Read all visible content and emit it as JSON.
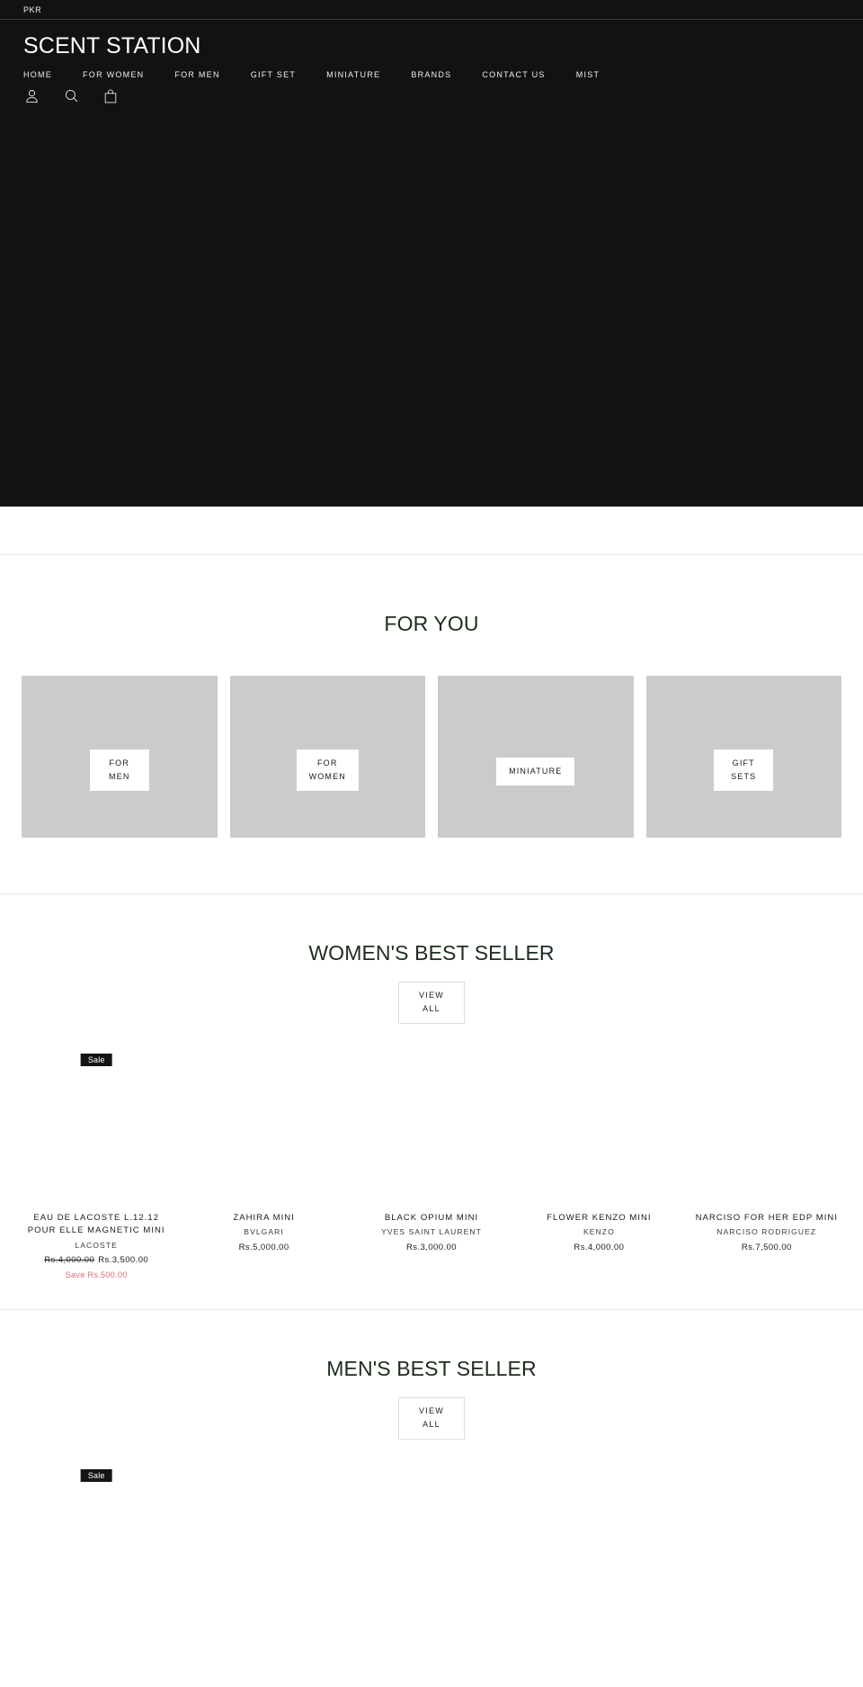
{
  "header": {
    "currency": "PKR",
    "brand_title": "SCENT STATION",
    "nav": [
      {
        "label": "HOME"
      },
      {
        "label": "FOR WOMEN"
      },
      {
        "label": "FOR MEN"
      },
      {
        "label": "GIFT SET"
      },
      {
        "label": "MINIATURE"
      },
      {
        "label": "BRANDS"
      },
      {
        "label": "CONTACT US"
      },
      {
        "label": "MIST"
      }
    ],
    "icons": [
      {
        "name": "account-icon"
      },
      {
        "name": "search-icon"
      },
      {
        "name": "cart-icon"
      }
    ],
    "background_color": "#121212"
  },
  "for_you": {
    "title": "FOR YOU",
    "collections": [
      {
        "label": "FOR\nMEN"
      },
      {
        "label": "FOR\nWOMEN"
      },
      {
        "label": "MINIATURE"
      },
      {
        "label": "GIFT\nSETS"
      }
    ],
    "placeholder_color": "#cbcbcb"
  },
  "womens_best_seller": {
    "title": "WOMEN'S BEST SELLER",
    "view_all_label": "VIEW\nALL",
    "products": [
      {
        "name": "EAU DE LACOSTE L.12.12 POUR ELLE MAGNETIC MINI",
        "vendor": "LACOSTE",
        "compare_price": "Rs.4,000.00",
        "price": "Rs.3,500.00",
        "save": "Save Rs.500.00",
        "badge": "Sale"
      },
      {
        "name": "ZAHIRA MINI",
        "vendor": "BVLGARI",
        "compare_price": "",
        "price": "Rs.5,000.00",
        "save": "",
        "badge": ""
      },
      {
        "name": "BLACK OPIUM MINI",
        "vendor": "YVES SAINT LAURENT",
        "compare_price": "",
        "price": "Rs.3,000.00",
        "save": "",
        "badge": ""
      },
      {
        "name": "FLOWER KENZO MINI",
        "vendor": "KENZO",
        "compare_price": "",
        "price": "Rs.4,000.00",
        "save": "",
        "badge": ""
      },
      {
        "name": "NARCISO FOR HER EDP MINI",
        "vendor": "NARCISO RODRIGUEZ",
        "compare_price": "",
        "price": "Rs.7,500.00",
        "save": "",
        "badge": ""
      }
    ]
  },
  "mens_best_seller": {
    "title": "MEN'S BEST SELLER",
    "view_all_label": "VIEW\nALL",
    "products": [
      {
        "name": "",
        "vendor": "",
        "compare_price": "",
        "price": "",
        "save": "",
        "badge": "Sale"
      }
    ]
  },
  "colors": {
    "sale_badge_bg": "#141414",
    "save_text": "#d86c6c",
    "heading": "#1b2d1b"
  }
}
